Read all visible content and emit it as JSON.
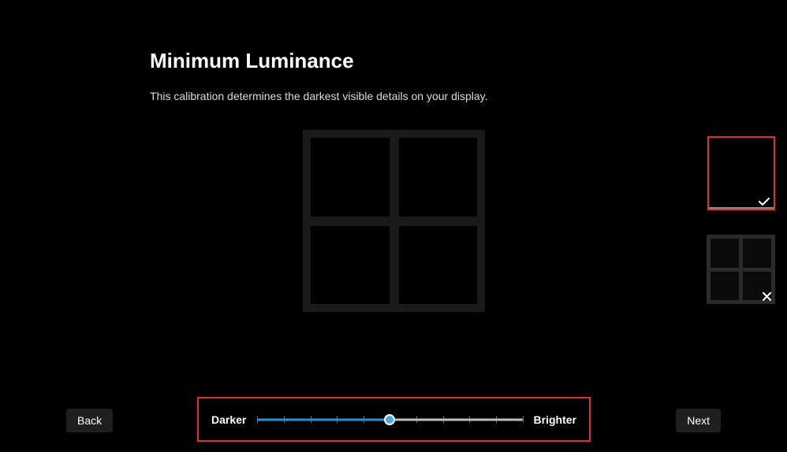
{
  "title": "Minimum Luminance",
  "subtitle": "This calibration determines the darkest visible details on your display.",
  "slider": {
    "label_left": "Darker",
    "label_right": "Brighter",
    "value_percent": 50
  },
  "buttons": {
    "back": "Back",
    "next": "Next"
  },
  "thumbnails": {
    "correct_state": "selected",
    "incorrect_state": "unselected"
  },
  "colors": {
    "highlight_border": "#e03030",
    "slider_fill": "#2a8fd8",
    "slider_thumb": "#4aa8e8"
  }
}
